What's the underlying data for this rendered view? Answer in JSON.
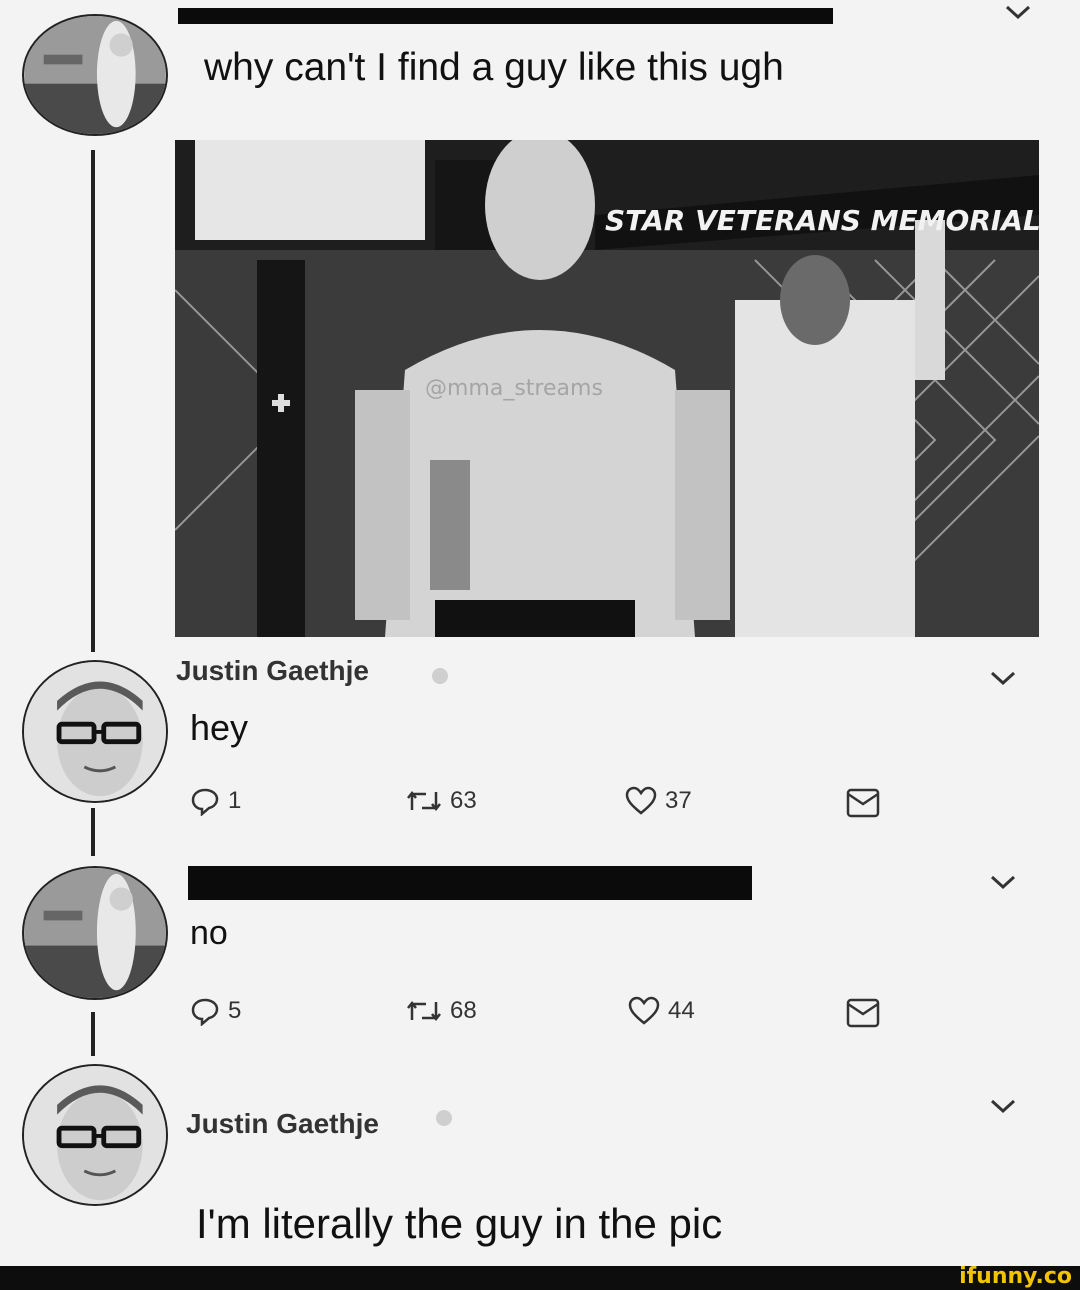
{
  "tweet1": {
    "text": "why can't I find a guy like this ugh",
    "media_banner_text": "STAR VETERANS MEMORIAL",
    "media_watermark": "@mma_streams"
  },
  "reply1": {
    "name": "Justin Gaethje",
    "text": "hey",
    "actions": {
      "replies": "1",
      "retweets": "63",
      "likes": "37"
    }
  },
  "reply2": {
    "text": "no",
    "actions": {
      "replies": "5",
      "retweets": "68",
      "likes": "44"
    }
  },
  "reply3": {
    "name": "Justin Gaethje",
    "text": "I'm literally the guy in the pic"
  },
  "footer": {
    "brand": "ifunny.co"
  }
}
